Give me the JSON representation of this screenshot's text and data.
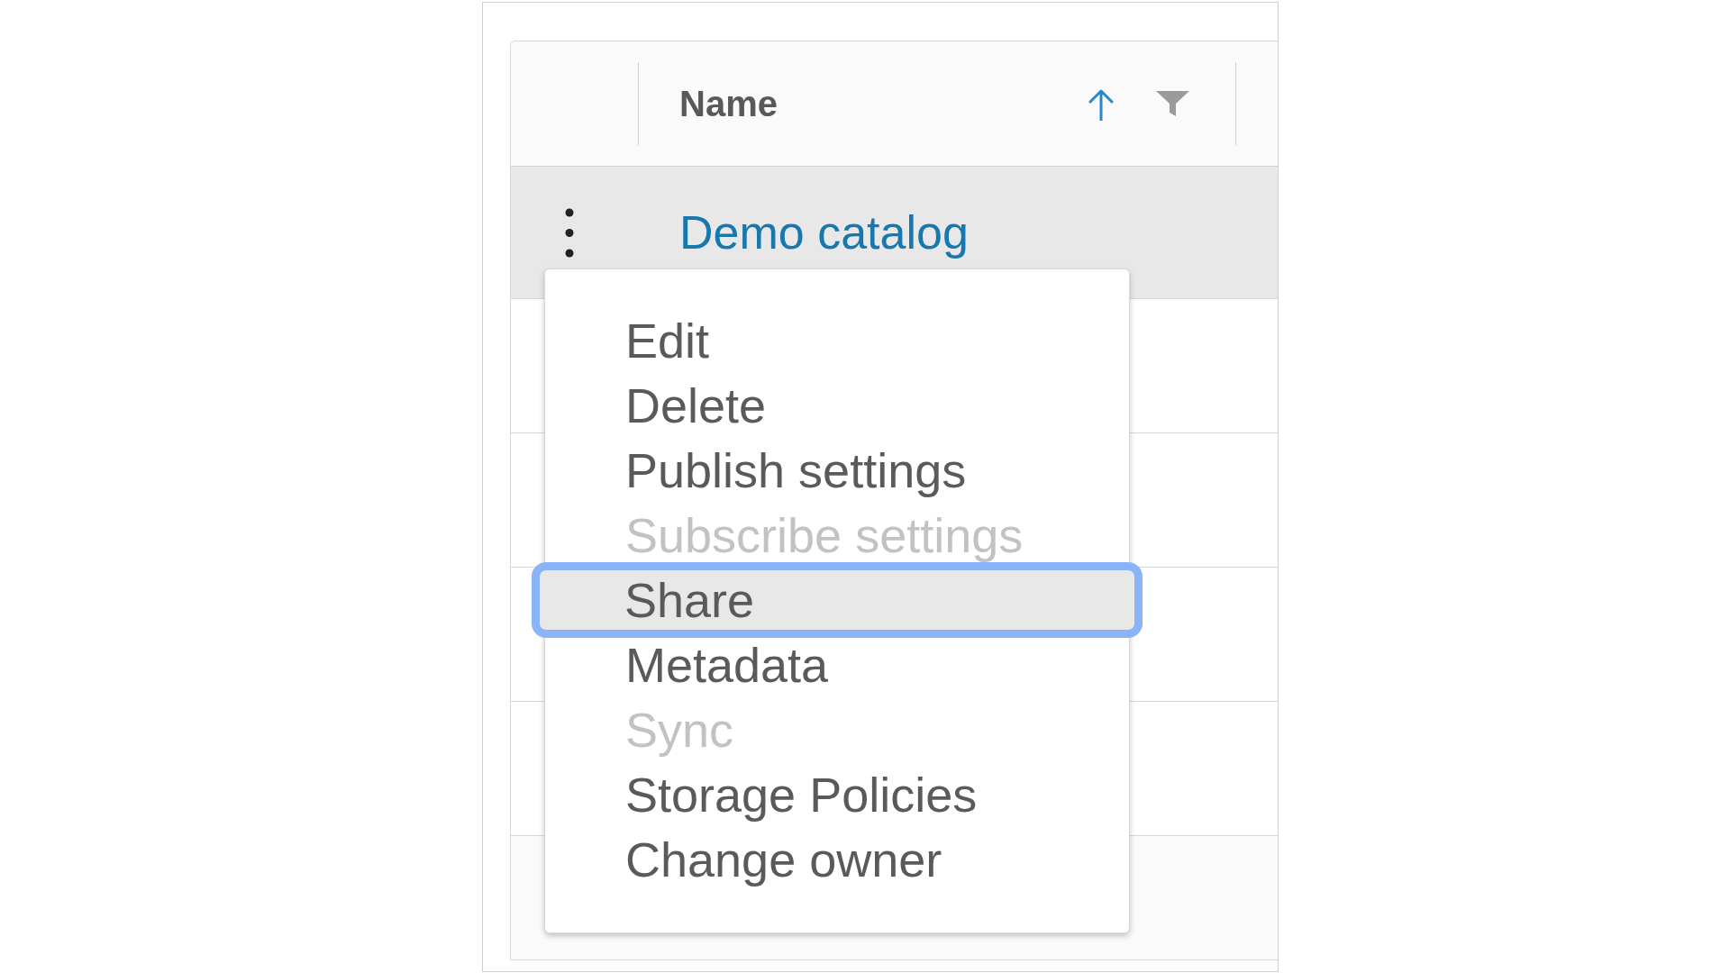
{
  "table": {
    "columns": [
      {
        "label": "Name",
        "sorted": true,
        "filterable": true
      }
    ],
    "rows": [
      {
        "name": "Demo catalog",
        "selected": true
      }
    ]
  },
  "action_menu": {
    "items": [
      {
        "label": "Edit",
        "disabled": false,
        "focused": false
      },
      {
        "label": "Delete",
        "disabled": false,
        "focused": false
      },
      {
        "label": "Publish settings",
        "disabled": false,
        "focused": false
      },
      {
        "label": "Subscribe settings",
        "disabled": true,
        "focused": false
      },
      {
        "label": "Share",
        "disabled": false,
        "focused": true
      },
      {
        "label": "Metadata",
        "disabled": false,
        "focused": false
      },
      {
        "label": "Sync",
        "disabled": true,
        "focused": false
      },
      {
        "label": "Storage Policies",
        "disabled": false,
        "focused": false
      },
      {
        "label": "Change owner",
        "disabled": false,
        "focused": false
      }
    ]
  }
}
